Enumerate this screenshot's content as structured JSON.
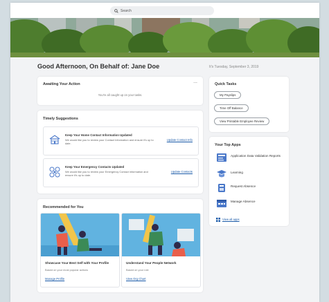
{
  "search": {
    "placeholder": "Search"
  },
  "greeting": "Good Afternoon, On Behalf of: Jane Doe",
  "date_text": "It's Tuesday, September 3, 2019",
  "awaiting": {
    "title": "Awaiting Your Action",
    "more": "...",
    "empty_text": "You're all caught up on your tasks."
  },
  "suggestions": {
    "title": "Timely Suggestions",
    "items": [
      {
        "title": "Keep Your Home Contact Information Updated",
        "desc": "We would like you to review your Contact Information and ensure it's up to date.",
        "link": "Update Contact Info",
        "icon": "house-icon"
      },
      {
        "title": "Keep Your Emergency Contacts Updated",
        "desc": "We would like you to review your Emergency Contact information and ensure it's up to date.",
        "link": "Update Contacts",
        "icon": "network-icon"
      }
    ]
  },
  "recommended": {
    "title": "Recommended for You",
    "items": [
      {
        "title": "Showcase Your Best Self with Your Profile",
        "desc": "Based on your most popular actions",
        "link": "Manage Profile"
      },
      {
        "title": "Understand Your People Network",
        "desc": "Based on your role",
        "link": "View Org Chart"
      }
    ]
  },
  "quick_tasks": {
    "title": "Quick Tasks",
    "items": [
      "My Payslips",
      "Time Off Balance",
      "View Printable Employee Review"
    ]
  },
  "top_apps": {
    "title": "Your Top Apps",
    "items": [
      {
        "label": "Application Data Validation Reports",
        "icon": "report-icon"
      },
      {
        "label": "Learning",
        "icon": "learning-icon"
      },
      {
        "label": "Request Absence",
        "icon": "absence-icon"
      },
      {
        "label": "Manage Absence",
        "icon": "calendar-icon"
      }
    ],
    "view_all": "View all apps"
  },
  "colors": {
    "accent": "#1a5aa8",
    "app_icon_blue": "#4a78c9",
    "background": "#f2f3f5",
    "illustration_bg": "#61b3e0"
  }
}
